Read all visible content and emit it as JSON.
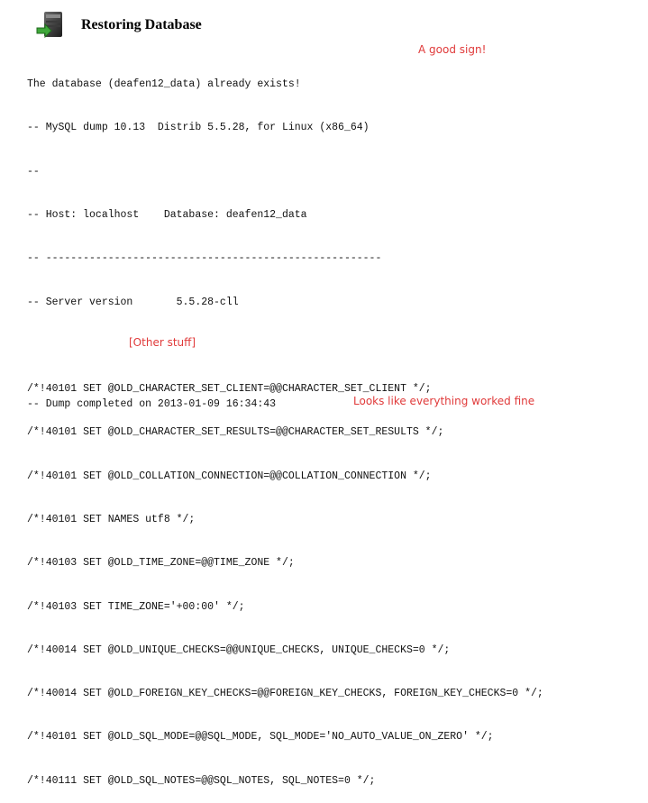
{
  "header": {
    "icon": "database-restore-icon",
    "title": "Restoring Database"
  },
  "log": {
    "block1": [
      "The database (deafen12_data) already exists!",
      "-- MySQL dump 10.13  Distrib 5.5.28, for Linux (x86_64)",
      "--",
      "-- Host: localhost    Database: deafen12_data",
      "-- ------------------------------------------------------",
      "-- Server version       5.5.28-cll"
    ],
    "block2": [
      "/*!40101 SET @OLD_CHARACTER_SET_CLIENT=@@CHARACTER_SET_CLIENT */;",
      "/*!40101 SET @OLD_CHARACTER_SET_RESULTS=@@CHARACTER_SET_RESULTS */;",
      "/*!40101 SET @OLD_COLLATION_CONNECTION=@@COLLATION_CONNECTION */;",
      "/*!40101 SET NAMES utf8 */;",
      "/*!40103 SET @OLD_TIME_ZONE=@@TIME_ZONE */;",
      "/*!40103 SET TIME_ZONE='+00:00' */;",
      "/*!40014 SET @OLD_UNIQUE_CHECKS=@@UNIQUE_CHECKS, UNIQUE_CHECKS=0 */;",
      "/*!40014 SET @OLD_FOREIGN_KEY_CHECKS=@@FOREIGN_KEY_CHECKS, FOREIGN_KEY_CHECKS=0 */;",
      "/*!40101 SET @OLD_SQL_MODE=@@SQL_MODE, SQL_MODE='NO_AUTO_VALUE_ON_ZERO' */;",
      "/*!40111 SET @OLD_SQL_NOTES=@@SQL_NOTES, SQL_NOTES=0 */;"
    ],
    "footer": "-- Dump completed on 2013-01-09 16:34:43"
  },
  "annotations": {
    "good_sign": "A good sign!",
    "other_stuff": "[Other stuff]",
    "worked_fine": "Looks like everything worked fine",
    "color": "#e03a3a"
  }
}
